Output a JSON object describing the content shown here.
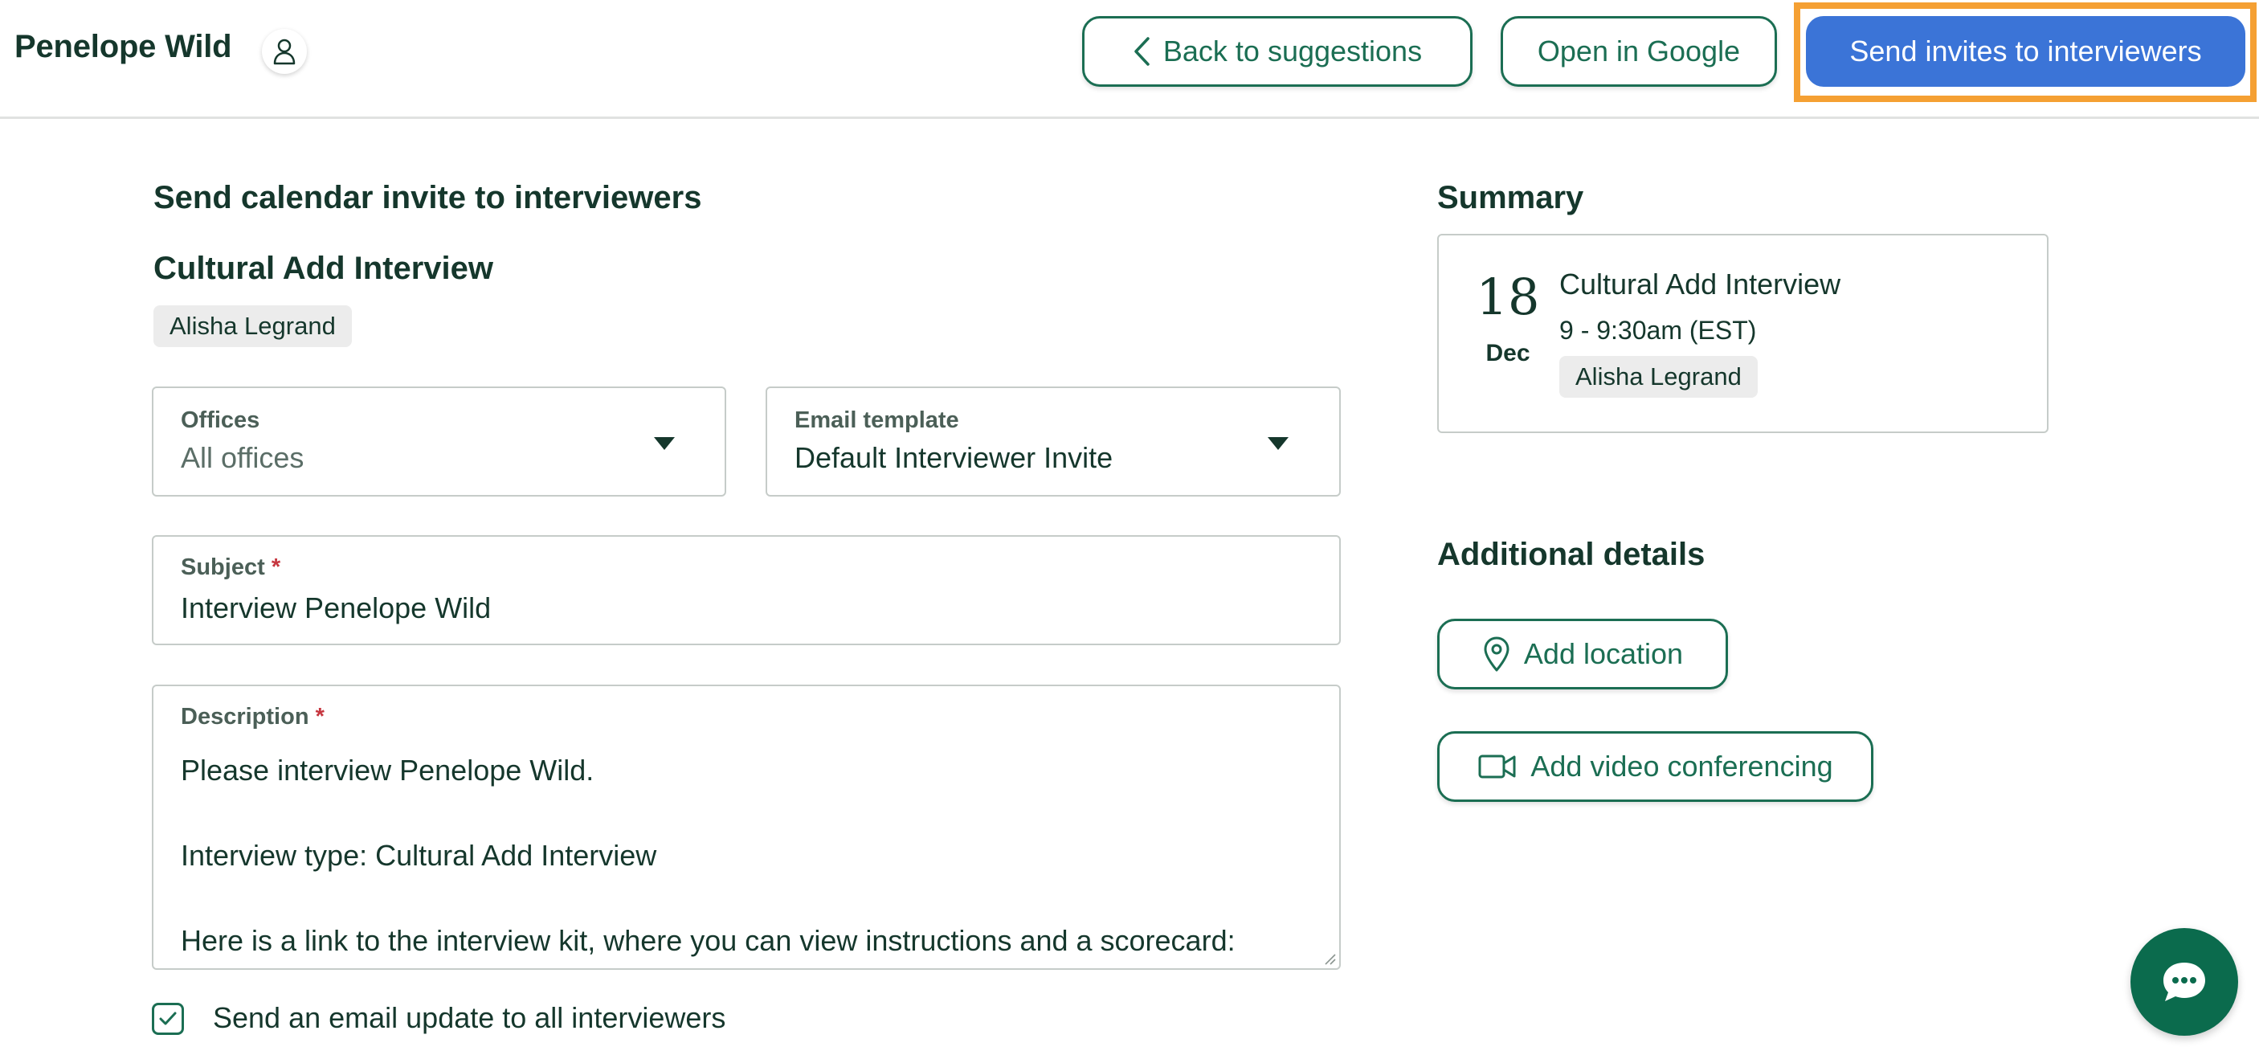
{
  "header": {
    "candidate_name": "Penelope Wild",
    "back_button_label": "Back to suggestions",
    "google_button_label": "Open in Google",
    "send_button_label": "Send invites to interviewers"
  },
  "form": {
    "heading": "Send calendar invite to interviewers",
    "interview_name": "Cultural Add Interview",
    "interviewer_tag": "Alisha Legrand",
    "offices": {
      "label": "Offices",
      "value": "All offices"
    },
    "email_template": {
      "label": "Email template",
      "value": "Default Interviewer Invite"
    },
    "subject": {
      "label": "Subject",
      "required_mark": "*",
      "value": "Interview Penelope Wild"
    },
    "description": {
      "label": "Description",
      "required_mark": "*",
      "value": "Please interview Penelope Wild.\n\nInterview type: Cultural Add Interview\n\nHere is a link to the interview kit, where you can view instructions and a scorecard:"
    },
    "email_update": {
      "label": "Send an email update to all interviewers",
      "checked": true
    }
  },
  "summary": {
    "heading": "Summary",
    "day": "18",
    "month": "Dec",
    "title": "Cultural Add Interview",
    "time": "9 - 9:30am (EST)",
    "interviewer_tag": "Alisha Legrand"
  },
  "additional": {
    "heading": "Additional details",
    "add_location_label": "Add location",
    "add_video_label": "Add video conferencing"
  },
  "icons": {
    "profile": "person-icon",
    "back": "chevron-left-icon",
    "dropdown": "caret-down-icon",
    "location": "map-pin-icon",
    "video": "video-camera-icon",
    "checkbox": "checkmark-icon",
    "chat": "chat-bubble-icon"
  },
  "colors": {
    "primary_green": "#1b6e53",
    "text_dark": "#15372c",
    "send_button_blue": "#3b74d7",
    "highlight_orange": "#f5a033",
    "chat_button": "#0b6b4d"
  }
}
